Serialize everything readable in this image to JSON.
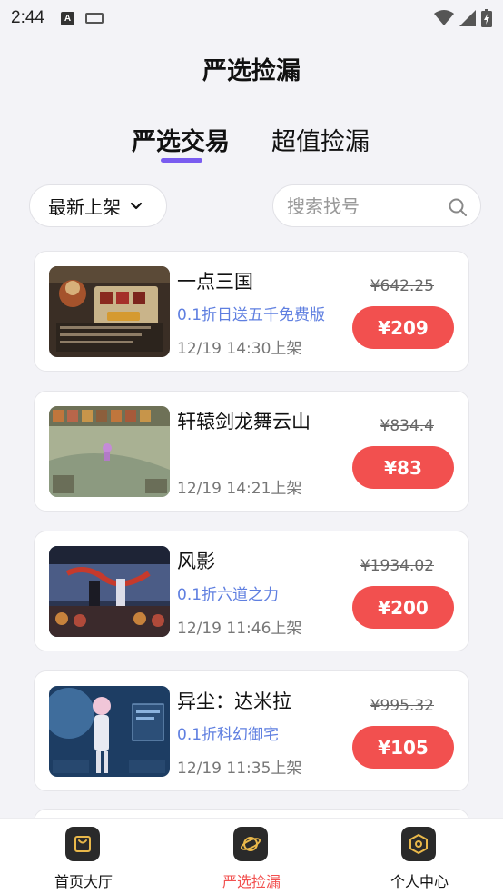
{
  "status_bar": {
    "time": "2:44",
    "icons": [
      "font-a-icon",
      "keyboard-icon",
      "wifi-icon",
      "signal-icon",
      "battery-charging-icon"
    ]
  },
  "header": {
    "title": "严选捡漏"
  },
  "tabs": [
    {
      "label": "严选交易",
      "active": true
    },
    {
      "label": "超值捡漏",
      "active": false
    }
  ],
  "filters": {
    "sort_label": "最新上架",
    "search_placeholder": "搜索找号"
  },
  "listings": [
    {
      "title": "一点三国",
      "promo": "0.1折日送五千免费版",
      "time": "12/19 14:30上架",
      "old_price": "¥642.25",
      "price": "¥209"
    },
    {
      "title": "轩辕剑龙舞云山",
      "promo": "",
      "time": "12/19 14:21上架",
      "old_price": "¥834.4",
      "price": "¥83"
    },
    {
      "title": "风影",
      "promo": "0.1折六道之力",
      "time": "12/19 11:46上架",
      "old_price": "¥1934.02",
      "price": "¥200"
    },
    {
      "title": "异尘：达米拉",
      "promo": "0.1折科幻御宅",
      "time": "12/19 11:35上架",
      "old_price": "¥995.32",
      "price": "¥105"
    }
  ],
  "bottom_nav": [
    {
      "label": "首页大厅",
      "icon": "bag-icon",
      "active": false
    },
    {
      "label": "严选捡漏",
      "icon": "planet-icon",
      "active": true
    },
    {
      "label": "个人中心",
      "icon": "hexagon-icon",
      "active": false
    }
  ],
  "colors": {
    "accent": "#7a5cf0",
    "price_button": "#f2504f",
    "promo_text": "#5f7fe0",
    "background": "#f3f3f7"
  }
}
